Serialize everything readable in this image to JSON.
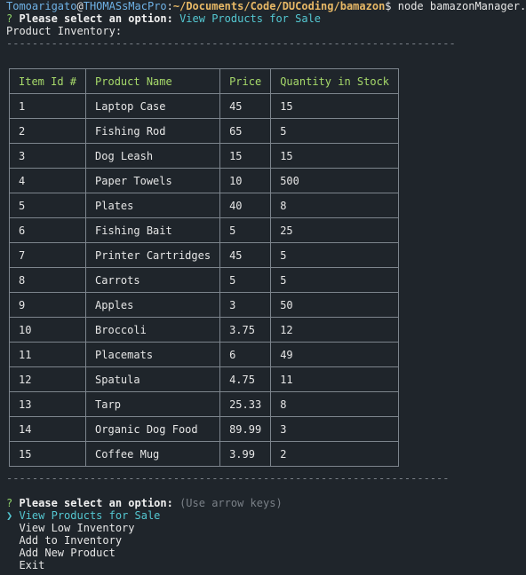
{
  "prompt_line": {
    "user": "Tomoarigato",
    "at": "@",
    "host": "THOMASsMacPro",
    "colon": ":",
    "path": "~/Documents/Code/DUCoding/bamazon",
    "dollar": "$ ",
    "command": "node bamazonManager.js"
  },
  "first_question": {
    "mark": "? ",
    "label": "Please select an option:",
    "answer": " View Products for Sale"
  },
  "heading": "Product Inventory:",
  "separator_top": "----------------------------------------------------------------------",
  "table": {
    "headers": [
      "Item Id #",
      "Product Name",
      "Price",
      "Quantity in Stock"
    ],
    "rows": [
      [
        "1",
        "Laptop Case",
        "45",
        "15"
      ],
      [
        "2",
        "Fishing Rod",
        "65",
        "5"
      ],
      [
        "3",
        "Dog Leash",
        "15",
        "15"
      ],
      [
        "4",
        "Paper Towels",
        "10",
        "500"
      ],
      [
        "5",
        "Plates",
        "40",
        "8"
      ],
      [
        "6",
        "Fishing Bait",
        "5",
        "25"
      ],
      [
        "7",
        "Printer Cartridges",
        "45",
        "5"
      ],
      [
        "8",
        "Carrots",
        "5",
        "5"
      ],
      [
        "9",
        "Apples",
        "3",
        "50"
      ],
      [
        "10",
        "Broccoli",
        "3.75",
        "12"
      ],
      [
        "11",
        "Placemats",
        "6",
        "49"
      ],
      [
        "12",
        "Spatula",
        "4.75",
        "11"
      ],
      [
        "13",
        "Tarp",
        "25.33",
        "8"
      ],
      [
        "14",
        "Organic Dog Food",
        "89.99",
        "3"
      ],
      [
        "15",
        "Coffee Mug",
        "3.99",
        "2"
      ]
    ]
  },
  "separator_bottom": "---------------------------------------------------------------------",
  "second_question": {
    "mark": "? ",
    "label": "Please select an option:",
    "hint": " (Use arrow keys)"
  },
  "menu": {
    "pointer": "❯",
    "items": [
      "View Products for Sale",
      "View Low Inventory",
      "Add to Inventory",
      "Add New Product",
      "Exit"
    ],
    "selected_index": 0
  }
}
